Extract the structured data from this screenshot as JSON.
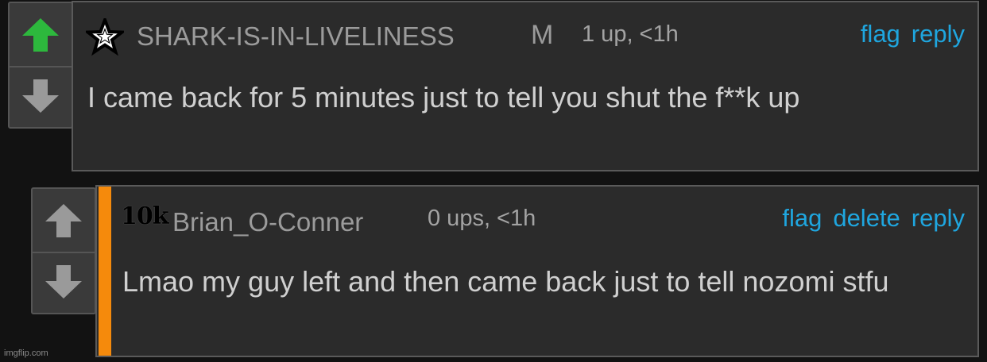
{
  "colors": {
    "background": "#121212",
    "panel": "#2b2b2b",
    "link": "#1fa6df",
    "upvote_active": "#2db83d",
    "arrow_inactive": "#9a9a9a",
    "highlight_bar": "#f58a0c"
  },
  "comment1": {
    "rank_icon": "star-outline-icon",
    "username": "SHARK-IS-IN-LIVELINESS",
    "gender": "M",
    "meta": "1 up, <1h",
    "actions": {
      "flag": "flag",
      "reply": "reply"
    },
    "text": "I came back for 5 minutes just to tell you shut the f**k up",
    "upvoted": true
  },
  "comment2": {
    "badge": "10k",
    "username": "Brian_O-Conner",
    "meta": "0 ups, <1h",
    "actions": {
      "flag": "flag",
      "delete": "delete",
      "reply": "reply"
    },
    "text": "Lmao my guy left and then came back just to tell nozomi stfu",
    "upvoted": false
  },
  "watermark": "imgflip.com"
}
